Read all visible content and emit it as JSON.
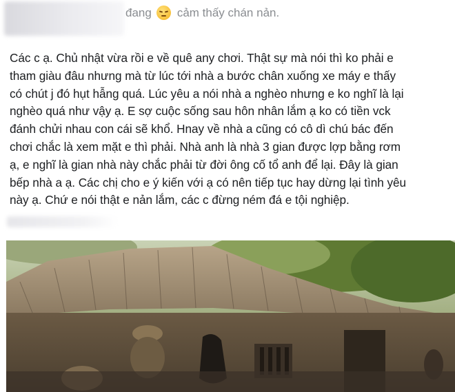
{
  "post": {
    "status_prefix": "đang",
    "feeling_icon": "sad-face-emoji",
    "feeling_text": "cảm thấy chán nản.",
    "body": "Các c ạ. Chủ nhật vừa rồi e về quê any chơi. Thật sự mà nói thì ko phải e\ntham giàu đâu nhưng mà từ lúc tới nhà a bước chân xuống xe máy e thấy\ncó chút j đó hụt hẫng quá. Lúc yêu a nói nhà a nghèo nhưng e ko nghĩ là lại\nnghèo quá như vậy ạ. E sợ cuộc sống sau hôn nhân lắm ạ ko có tiền vck\nđánh chửi nhau con cái sẽ khổ. Hnay về nhà a cũng có cô dì chú bác đến\nchơi chắc là xem mặt e thì phải. Nhà anh là nhà 3 gian được lợp bằng rơm\nạ, e nghĩ là gian nhà này chắc phải từ đời ông cố tổ anh để lại. Đây là gian\nbếp nhà a ạ. Các chị cho e ý kiến với ạ có nên tiếp tục hay dừng lại tình yêu\nnày ạ. Chứ e nói thật e nản lắm, các c đừng ném đá e tội nghiệp."
  },
  "colors": {
    "text": "#1c1e21",
    "muted": "#8a8d91",
    "background": "#ffffff"
  }
}
